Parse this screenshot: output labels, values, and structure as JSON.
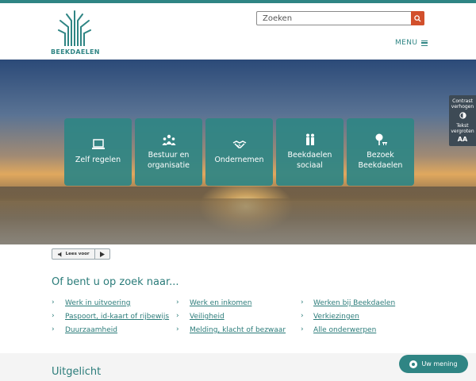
{
  "header": {
    "logo_text": "BEEKDAELEN",
    "search": {
      "placeholder": "Zoeken",
      "icon": "search-icon"
    },
    "menu_label": "MENU"
  },
  "hero": {
    "tiles": [
      {
        "label": "Zelf regelen",
        "icon": "laptop-icon"
      },
      {
        "label": "Bestuur en organisatie",
        "icon": "people-icon"
      },
      {
        "label": "Ondernemen",
        "icon": "handshake-icon"
      },
      {
        "label": "Beekdaelen sociaal",
        "icon": "family-icon"
      },
      {
        "label": "Bezoek Beekdaelen",
        "icon": "tree-icon"
      }
    ]
  },
  "accessibility": {
    "contrast_label": "Contrast verhogen",
    "text_label": "Tekst vergroten",
    "text_glyph": "AA"
  },
  "readspeaker": {
    "label": "Lees voor"
  },
  "search_suggestions": {
    "title": "Of bent u op zoek naar...",
    "columns": [
      [
        "Werk in uitvoering",
        "Paspoort, id-kaart of rijbewijs",
        "Duurzaamheid"
      ],
      [
        "Werk en inkomen",
        "Veiligheid",
        "Melding, klacht of bezwaar"
      ],
      [
        "Werken bij Beekdaelen",
        "Verkiezingen",
        "Alle onderwerpen"
      ]
    ]
  },
  "highlight": {
    "title": "Uitgelicht"
  },
  "feedback": {
    "label": "Uw mening"
  },
  "colors": {
    "brand": "#2f8584",
    "search_button": "#d2502c"
  }
}
